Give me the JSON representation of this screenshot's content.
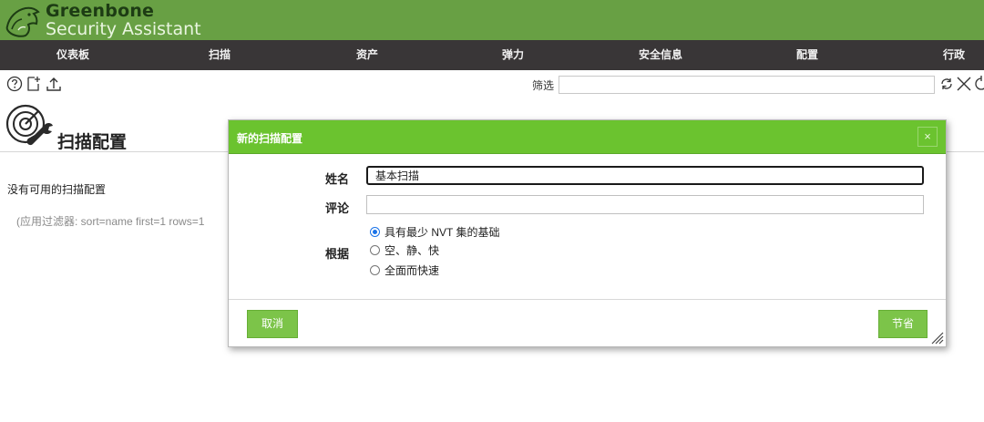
{
  "brand": {
    "line1": "Greenbone",
    "line2": "Security Assistant"
  },
  "nav": [
    "仪表板",
    "扫描",
    "资产",
    "弹力",
    "安全信息",
    "配置",
    "行政"
  ],
  "toolbar": {
    "help_icon": "help-circle-icon",
    "new_icon": "new-document-icon",
    "upload_icon": "upload-icon",
    "filter_label": "筛选",
    "filter_value": ""
  },
  "page": {
    "title": "扫描配置",
    "empty_message": "没有可用的扫描配置",
    "applied_filter": "(应用过滤器: sort=name first=1 rows=1"
  },
  "dialog": {
    "title": "新的扫描配置",
    "close_label": "×",
    "name_label": "姓名",
    "name_value": "基本扫描",
    "comment_label": "评论",
    "comment_value": "",
    "base_label": "根据",
    "base_options": [
      {
        "label": "具有最少 NVT 集的基础",
        "selected": true
      },
      {
        "label": "空、静、快",
        "selected": false
      },
      {
        "label": "全面而快速",
        "selected": false
      }
    ],
    "cancel_label": "取消",
    "save_label": "节省"
  },
  "colors": {
    "header_green": "#68a044",
    "nav_dark": "#393637",
    "dialog_header": "#6bc32f",
    "button_green": "#7cc449",
    "radio_accent": "#1a73e8"
  }
}
